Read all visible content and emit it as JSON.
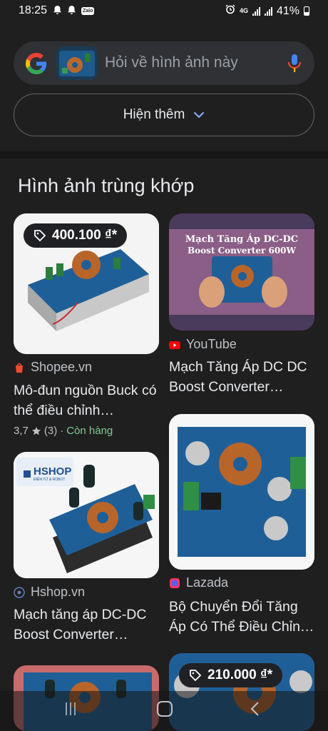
{
  "status": {
    "time": "18:25",
    "net_label": "4G",
    "battery": "41%",
    "notification_icons": [
      "bell-icon",
      "bell-icon",
      "zalo-icon"
    ],
    "zalo_label": "Zalo"
  },
  "search": {
    "placeholder": "Hỏi về hình ảnh này",
    "icon": "google-logo",
    "mic_icon": "mic-icon"
  },
  "more_button": {
    "label": "Hiện thêm",
    "icon": "chevron-down-icon"
  },
  "section": {
    "title": "Hình ảnh trùng khớp"
  },
  "results": [
    {
      "price": "400.100 ₫*",
      "source": "Shopee.vn",
      "title": "Mô-đun nguồn Buck có thể điều chỉnh…",
      "rating": "3,7",
      "reviews": "(3)",
      "separator": "·",
      "stock": "Còn hàng"
    },
    {
      "image_caption_1": "Mạch Tăng Áp DC-DC",
      "image_caption_2": "Boost Converter 600W",
      "source": "YouTube",
      "title": "Mạch Tăng Áp DC DC Boost Converter…"
    },
    {
      "image_brand": "HSHOP",
      "image_brand_sub": "ĐIỆN TỬ & ROBOT",
      "source": "Hshop.vn",
      "title": "Mạch tăng áp DC-DC Boost Converter…"
    },
    {
      "source": "Lazada",
      "title": "Bộ Chuyển Đổi Tăng Áp Có Thể Điều Chỉn…"
    },
    {
      "image": "boost-converter-board"
    },
    {
      "price": "210.000 ₫*"
    }
  ],
  "colors": {
    "background": "#1f1f1f",
    "search_bg": "#303134",
    "stock_green": "#81c995",
    "shopee_orange": "#ee4d2d",
    "youtube_red": "#ff0000",
    "lazada_pink": "#f36"
  }
}
